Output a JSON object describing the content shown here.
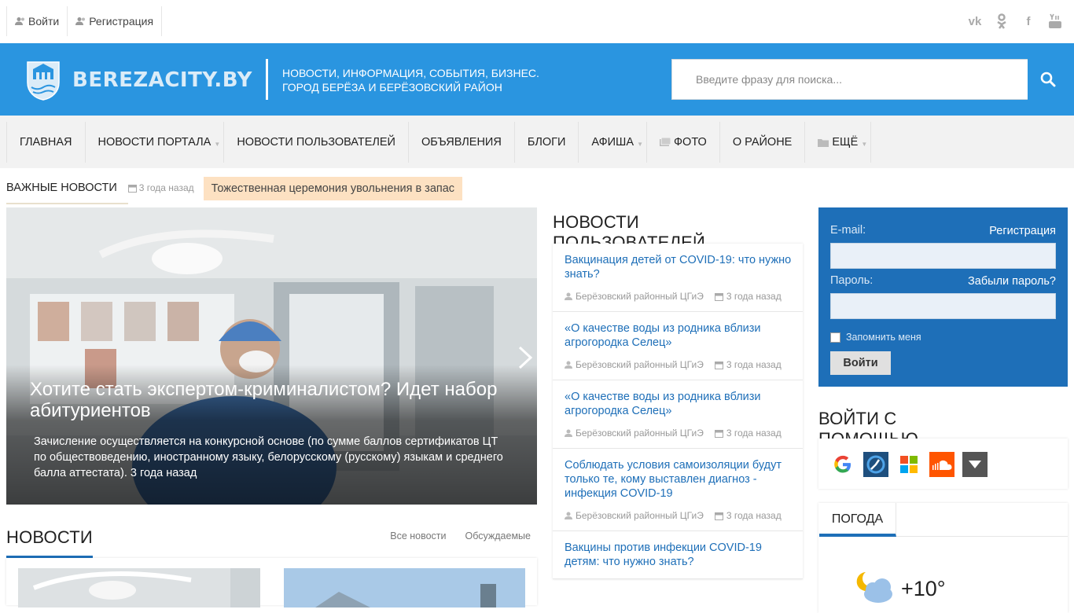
{
  "top": {
    "login": "Войти",
    "register": "Регистрация"
  },
  "social": [
    "vk-icon",
    "odnoklassniki-icon",
    "facebook-icon",
    "youtube-icon"
  ],
  "header": {
    "logo_text": "BEREZACITY.BY",
    "tagline_1": "НОВОСТИ, ИНФОРМАЦИЯ, СОБЫТИЯ, БИЗНЕС.",
    "tagline_2": "ГОРОД БЕРЁЗА И БЕРЁЗОВСКИЙ РАЙОН",
    "search_placeholder": "Введите фразу для поиска..."
  },
  "nav": [
    {
      "label": "ГЛАВНАЯ"
    },
    {
      "label": "НОВОСТИ ПОРТАЛА"
    },
    {
      "label": "НОВОСТИ ПОЛЬЗОВАТЕЛЕЙ"
    },
    {
      "label": "ОБЪЯВЛЕНИЯ"
    },
    {
      "label": "БЛОГИ"
    },
    {
      "label": "АФИША"
    },
    {
      "label": "ФОТО"
    },
    {
      "label": "О РАЙОНЕ"
    },
    {
      "label": "ЕЩЁ"
    }
  ],
  "breaking": {
    "label": "ВАЖНЫЕ НОВОСТИ",
    "date": "3 года назад",
    "title": "Тожественная церемония увольнения в запас"
  },
  "slide": {
    "title": "Хотите стать экспертом-криминалистом? Идет набор абитуриентов",
    "text": "Зачисление осуществляется на конкурсной основе (по сумме баллов сертификатов ЦТ по обществоведению, иностранному языку, белорусскому (русскому) языкам и среднего балла аттестата). 3 года назад"
  },
  "news": {
    "title": "НОВОСТИ",
    "all": "Все новости",
    "discussed": "Обсуждаемые"
  },
  "user_news": {
    "title": "НОВОСТИ ПОЛЬЗОВАТЕЛЕЙ",
    "items": [
      {
        "title": "Вакцинация детей от COVID-19: что нужно знать?",
        "author": "Берёзовский районный ЦГиЭ",
        "date": "3 года назад"
      },
      {
        "title": "«О качестве воды из родника вблизи агрогородка Селец»",
        "author": "Берёзовский районный ЦГиЭ",
        "date": "3 года назад"
      },
      {
        "title": "«О качестве воды из родника вблизи агрогородка Селец»",
        "author": "Берёзовский районный ЦГиЭ",
        "date": "3 года назад"
      },
      {
        "title": "Соблюдать условия самоизоляции будут только те, кому выставлен диагноз - инфекция COVID-19",
        "author": "Берёзовский районный ЦГиЭ",
        "date": "3 года назад"
      },
      {
        "title": "Вакцины против инфекции COVID-19 детям: что нужно знать?",
        "author": "",
        "date": ""
      }
    ]
  },
  "login": {
    "email_label": "E-mail:",
    "register": "Регистрация",
    "password_label": "Пароль:",
    "forgot": "Забыли пароль?",
    "remember": "Запомнить меня",
    "submit": "Войти"
  },
  "oauth": {
    "title": "ВОЙТИ С ПОМОЩЬЮ",
    "providers": [
      "google-icon",
      "openid-icon",
      "microsoft-icon",
      "soundcloud-icon",
      "more-icon"
    ]
  },
  "weather": {
    "tab": "ПОГОДА",
    "temp": "+10°"
  }
}
